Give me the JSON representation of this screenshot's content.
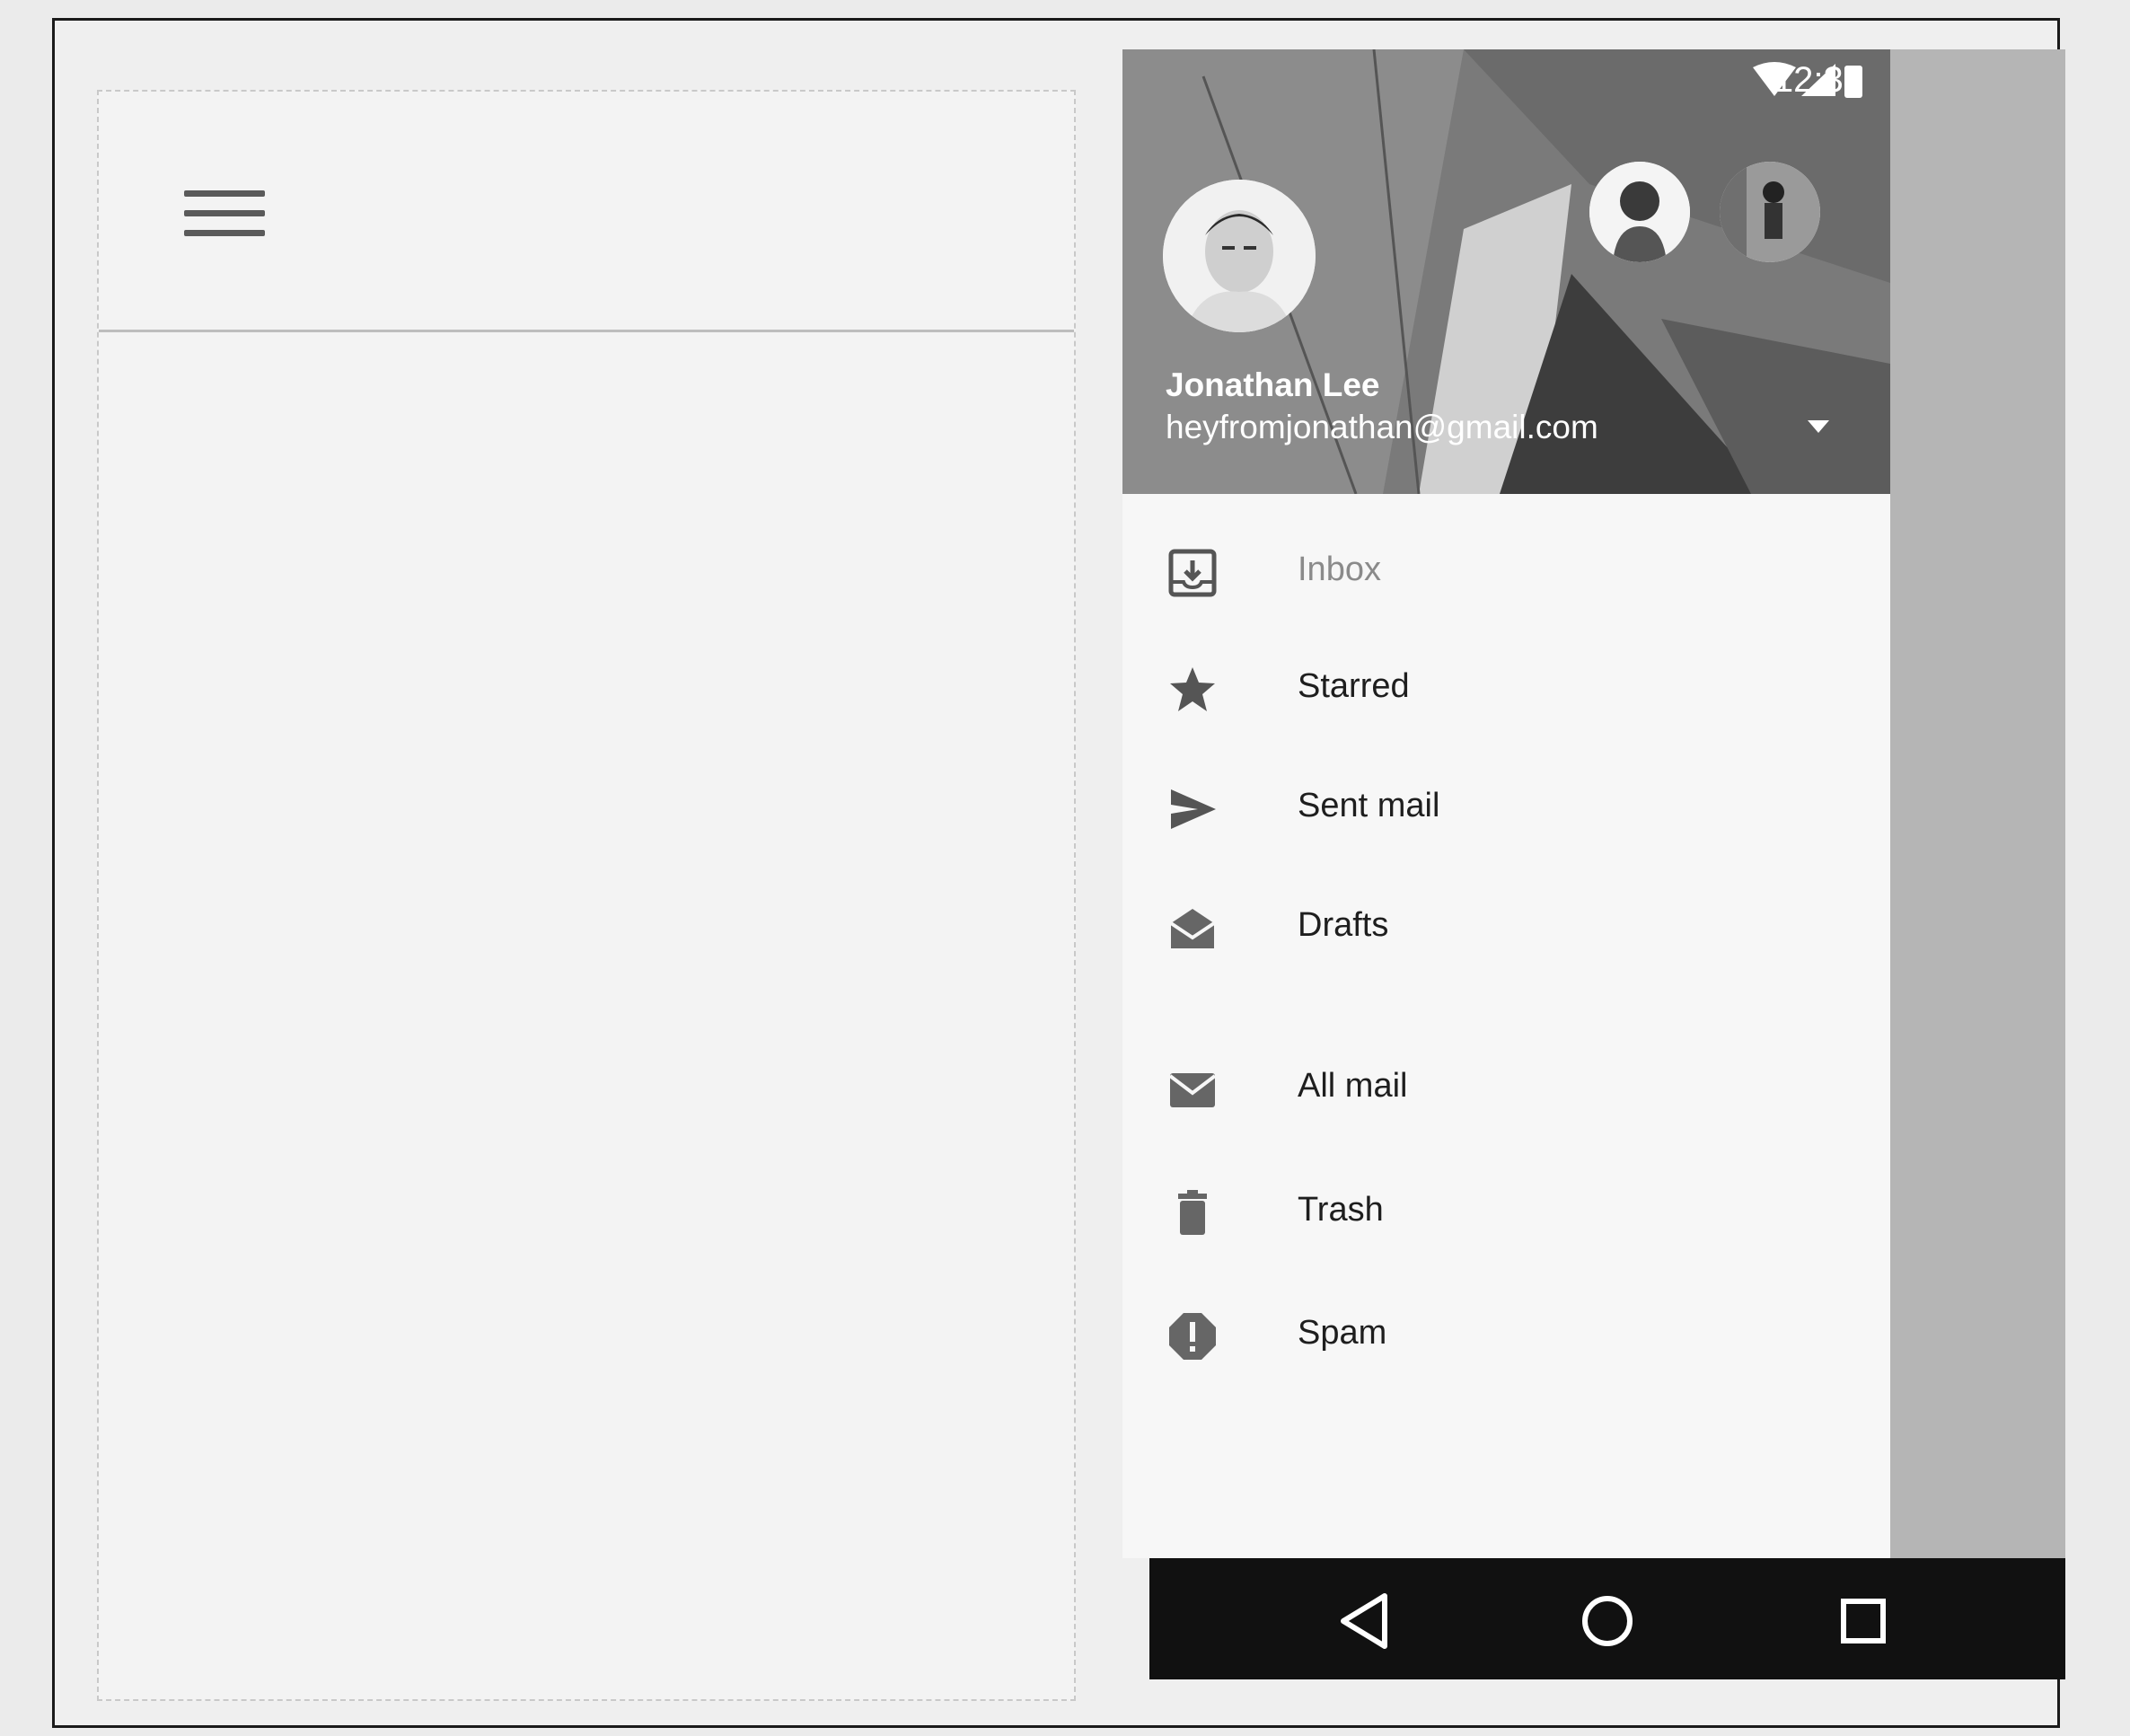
{
  "status_bar": {
    "time": "12:30",
    "icons": [
      "wifi-icon",
      "signal-icon",
      "battery-icon"
    ]
  },
  "account": {
    "name": "Jonathan Lee",
    "email": "heyfromjonathan@gmail.com"
  },
  "nav": {
    "items": [
      {
        "label": "Inbox",
        "icon": "inbox-icon"
      },
      {
        "label": "Starred",
        "icon": "star-icon"
      },
      {
        "label": "Sent mail",
        "icon": "send-icon"
      },
      {
        "label": "Drafts",
        "icon": "drafts-icon"
      },
      {
        "label": "All mail",
        "icon": "mail-icon"
      },
      {
        "label": "Trash",
        "icon": "trash-icon"
      },
      {
        "label": "Spam",
        "icon": "spam-icon"
      }
    ]
  },
  "system_nav": [
    "back-icon",
    "home-icon",
    "recents-icon"
  ],
  "colors": {
    "header_bg": "#7d7d7d",
    "drawer_bg": "#f7f7f7",
    "navbar_bg": "#111111"
  }
}
